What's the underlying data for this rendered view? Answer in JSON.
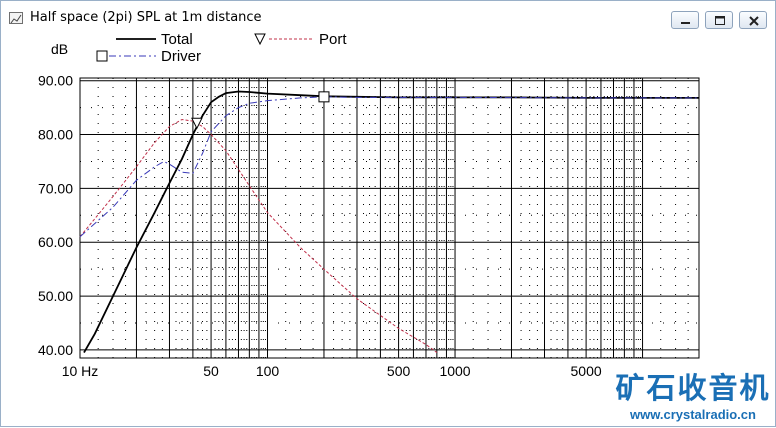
{
  "window": {
    "title": "Half space (2pi) SPL at 1m distance",
    "icon": "chart-window-icon",
    "controls": [
      "minimize-icon",
      "maximize-icon",
      "close-icon"
    ]
  },
  "watermark": {
    "title": "矿石收音机",
    "url": "www.crystalradio.cn",
    "color": "#1a6fb5"
  },
  "chart_data": {
    "type": "line",
    "title": "",
    "xlabel": "",
    "ylabel": "dB",
    "xscale": "log",
    "xlim": [
      10,
      20000
    ],
    "ylim": [
      38.5,
      90.5
    ],
    "grid": true,
    "legend_position": "top-left",
    "x_ticks": [
      {
        "value": 10,
        "label": "10 Hz"
      },
      {
        "value": 50,
        "label": "50"
      },
      {
        "value": 100,
        "label": "100"
      },
      {
        "value": 500,
        "label": "500"
      },
      {
        "value": 1000,
        "label": "1000"
      },
      {
        "value": 5000,
        "label": "5000"
      }
    ],
    "y_ticks": [
      {
        "value": 40,
        "label": "40.00"
      },
      {
        "value": 50,
        "label": "50.00"
      },
      {
        "value": 60,
        "label": "60.00"
      },
      {
        "value": 70,
        "label": "70.00"
      },
      {
        "value": 80,
        "label": "80.00"
      },
      {
        "value": 90,
        "label": "90.00"
      }
    ],
    "series": [
      {
        "name": "Total",
        "color": "#000000",
        "style": "solid",
        "marker": "none",
        "x": [
          10.5,
          12,
          15,
          20,
          25,
          30,
          35,
          40,
          45,
          50,
          55,
          60,
          70,
          80,
          100,
          150,
          200,
          300,
          500,
          1000,
          2000,
          5000,
          10000,
          20000
        ],
        "y": [
          39.5,
          43,
          50,
          59,
          65.5,
          71,
          75.5,
          80,
          83.5,
          86,
          87,
          87.7,
          88,
          87.9,
          87.6,
          87.3,
          87.1,
          87,
          86.9,
          86.9,
          86.9,
          86.8,
          86.8,
          86.8
        ]
      },
      {
        "name": "Port",
        "color": "#c0304a",
        "style": "dashed",
        "marker": "triangle-down",
        "marker_at": [
          42
        ],
        "x": [
          10,
          15,
          20,
          25,
          30,
          35,
          40,
          45,
          50,
          60,
          70,
          80,
          100,
          150,
          200,
          300,
          500,
          700,
          800
        ],
        "y": [
          61,
          68.5,
          74,
          78.5,
          81.5,
          82.8,
          82.5,
          81.5,
          80,
          77,
          73.5,
          70.5,
          65.5,
          59,
          55,
          49.5,
          44,
          41,
          39.5
        ]
      },
      {
        "name": "Driver",
        "color": "#3a3ab8",
        "style": "dashdot",
        "marker": "square",
        "marker_at": [
          200
        ],
        "x": [
          10,
          15,
          20,
          25,
          28,
          30,
          35,
          40,
          45,
          50,
          60,
          70,
          80,
          100,
          150,
          200,
          300,
          500,
          1000,
          5000,
          20000
        ],
        "y": [
          61,
          66.5,
          71.5,
          74,
          75,
          74.5,
          73,
          72.8,
          76.5,
          80.5,
          83.5,
          85,
          85.8,
          86.3,
          86.8,
          87,
          86.9,
          86.9,
          86.9,
          86.8,
          86.8
        ]
      }
    ]
  }
}
